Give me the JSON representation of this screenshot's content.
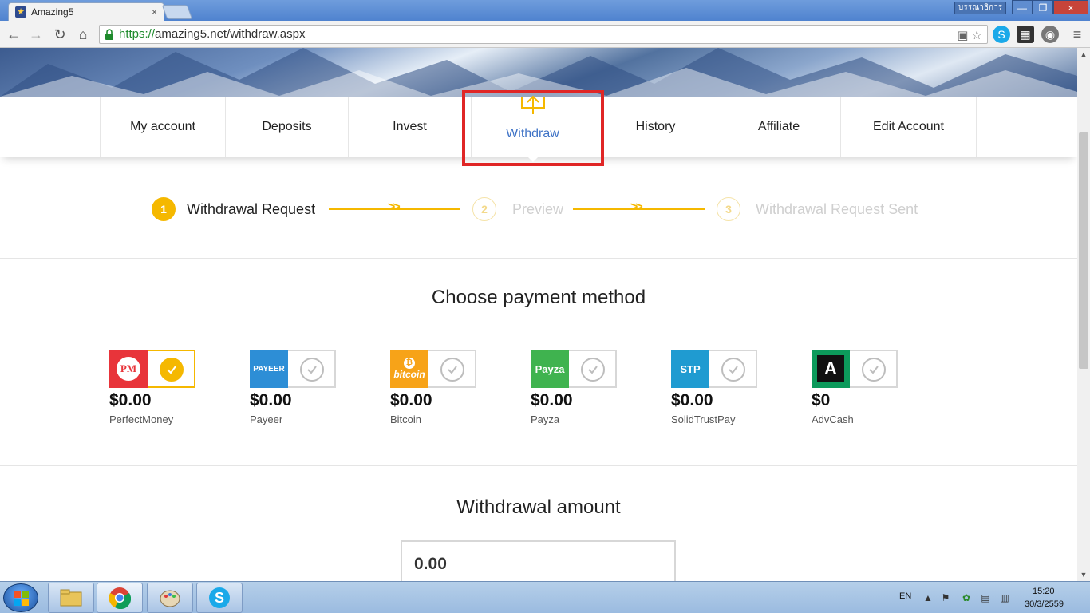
{
  "browser": {
    "tab_title": "Amazing5",
    "tab_close": "×",
    "user_badge": "บรรณาธิการ",
    "window_min": "—",
    "window_max": "❐",
    "window_close": "×",
    "url_scheme": "https://",
    "url_rest": "amazing5.net/withdraw.aspx"
  },
  "nav": {
    "items": [
      {
        "label": "My account"
      },
      {
        "label": "Deposits"
      },
      {
        "label": "Invest"
      },
      {
        "label": "Withdraw"
      },
      {
        "label": "History"
      },
      {
        "label": "Affiliate"
      },
      {
        "label": "Edit Account"
      }
    ],
    "active_index": 3
  },
  "steps": [
    {
      "number": "1",
      "label": "Withdrawal Request",
      "active": true
    },
    {
      "number": "2",
      "label": "Preview",
      "active": false
    },
    {
      "number": "3",
      "label": "Withdrawal Request Sent",
      "active": false
    }
  ],
  "payment": {
    "title": "Choose payment method",
    "methods": [
      {
        "logo_text": "PM",
        "amount": "$0.00",
        "name": "PerfectMoney",
        "color": "#e8343a",
        "selected": true
      },
      {
        "logo_text": "PAYEER",
        "amount": "$0.00",
        "name": "Payeer",
        "color": "#2d8ed6",
        "selected": false
      },
      {
        "logo_text": "bitcoin",
        "amount": "$0.00",
        "name": "Bitcoin",
        "color": "#f7a318",
        "selected": false
      },
      {
        "logo_text": "Payza",
        "amount": "$0.00",
        "name": "Payza",
        "color": "#3fb34f",
        "selected": false
      },
      {
        "logo_text": "STP",
        "amount": "$0.00",
        "name": "SolidTrustPay",
        "color": "#1f9bd1",
        "selected": false
      },
      {
        "logo_text": "A",
        "amount": "$0",
        "name": "AdvCash",
        "color": "#0c9a5b",
        "selected": false
      }
    ]
  },
  "withdrawal": {
    "title": "Withdrawal amount",
    "amount_value": "0.00"
  },
  "taskbar": {
    "language": "EN",
    "time": "15:20",
    "date": "30/3/2559"
  },
  "colors": {
    "accent": "#f5b800",
    "active_nav": "#3f73c6",
    "highlight": "#e02626"
  }
}
